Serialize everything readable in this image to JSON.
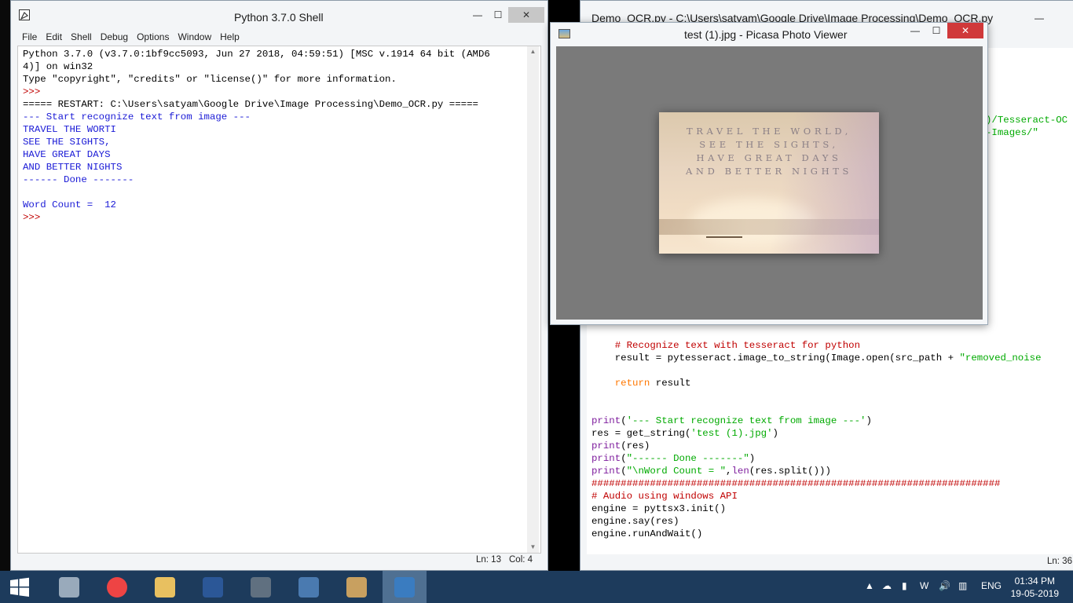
{
  "shell": {
    "title": "Python 3.7.0 Shell",
    "menu": [
      "File",
      "Edit",
      "Shell",
      "Debug",
      "Options",
      "Window",
      "Help"
    ],
    "lines": [
      {
        "text": "Python 3.7.0 (v3.7.0:1bf9cc5093, Jun 27 2018, 04:59:51) [MSC v.1914 64 bit (AMD6",
        "color": "blk"
      },
      {
        "text": "4)] on win32",
        "color": "blk"
      },
      {
        "text": "Type \"copyright\", \"credits\" or \"license()\" for more information.",
        "color": "blk"
      },
      {
        "text": ">>> ",
        "color": "red"
      },
      {
        "text": "===== RESTART: C:\\Users\\satyam\\Google Drive\\Image Processing\\Demo_OCR.py =====",
        "color": "blk"
      },
      {
        "text": "--- Start recognize text from image ---",
        "color": "blu"
      },
      {
        "text": "TRAVEL THE WORTI",
        "color": "blu"
      },
      {
        "text": "SEE THE SIGHTS,",
        "color": "blu"
      },
      {
        "text": "HAVE GREAT DAYS",
        "color": "blu"
      },
      {
        "text": "AND BETTER NIGHTS",
        "color": "blu"
      },
      {
        "text": "------ Done -------",
        "color": "blu"
      },
      {
        "text": "",
        "color": "blu"
      },
      {
        "text": "Word Count =  12",
        "color": "blu"
      },
      {
        "text": ">>> ",
        "color": "red"
      }
    ],
    "status_ln": "Ln: 13",
    "status_col": "Col: 4"
  },
  "editor": {
    "title": "Demo_OCR.py - C:\\Users\\satyam\\Google Drive\\Image Processing\\Demo_OCR.py",
    "visible_top": [
      {
        "text": ")/Tesseract-OC",
        "color": "grn"
      },
      {
        "text": "-Images/\"",
        "color": "grn"
      }
    ],
    "code": [
      [
        {
          "t": "    ",
          "c": "blk"
        },
        {
          "t": "# Recognize text with tesseract for python",
          "c": "red"
        }
      ],
      [
        {
          "t": "    result = pytesseract.image_to_string(Image.open(src_path + ",
          "c": "blk"
        },
        {
          "t": "\"removed_noise",
          "c": "grn"
        }
      ],
      [
        {
          "t": "",
          "c": "blk"
        }
      ],
      [
        {
          "t": "    ",
          "c": "blk"
        },
        {
          "t": "return",
          "c": "org"
        },
        {
          "t": " result",
          "c": "blk"
        }
      ],
      [
        {
          "t": "",
          "c": "blk"
        }
      ],
      [
        {
          "t": "",
          "c": "blk"
        }
      ],
      [
        {
          "t": "print",
          "c": "pur"
        },
        {
          "t": "(",
          "c": "blk"
        },
        {
          "t": "'--- Start recognize text from image ---'",
          "c": "grn"
        },
        {
          "t": ")",
          "c": "blk"
        }
      ],
      [
        {
          "t": "res = get_string(",
          "c": "blk"
        },
        {
          "t": "'test (1).jpg'",
          "c": "grn"
        },
        {
          "t": ")",
          "c": "blk"
        }
      ],
      [
        {
          "t": "print",
          "c": "pur"
        },
        {
          "t": "(res)",
          "c": "blk"
        }
      ],
      [
        {
          "t": "print",
          "c": "pur"
        },
        {
          "t": "(",
          "c": "blk"
        },
        {
          "t": "\"------ Done -------\"",
          "c": "grn"
        },
        {
          "t": ")",
          "c": "blk"
        }
      ],
      [
        {
          "t": "print",
          "c": "pur"
        },
        {
          "t": "(",
          "c": "blk"
        },
        {
          "t": "\"\\nWord Count = \"",
          "c": "grn"
        },
        {
          "t": ",",
          "c": "blk"
        },
        {
          "t": "len",
          "c": "pur"
        },
        {
          "t": "(res.split()))",
          "c": "blk"
        }
      ],
      [
        {
          "t": "######################################################################",
          "c": "red"
        }
      ],
      [
        {
          "t": "# Audio using windows API",
          "c": "red"
        }
      ],
      [
        {
          "t": "engine = pyttsx3.init()",
          "c": "blk"
        }
      ],
      [
        {
          "t": "engine.say(res)",
          "c": "blk"
        }
      ],
      [
        {
          "t": "engine.runAndWait()",
          "c": "blk"
        }
      ]
    ],
    "status_ln": "Ln: 36"
  },
  "picasa": {
    "title": "test (1).jpg - Picasa Photo Viewer",
    "photo_lines": [
      "TRAVEL THE WORLD,",
      "SEE THE SIGHTS,",
      "HAVE GREAT DAYS",
      "AND BETTER NIGHTS"
    ]
  },
  "taskbar": {
    "apps": [
      {
        "name": "resource-monitor",
        "color": "#9ab"
      },
      {
        "name": "chrome",
        "color": "#e44"
      },
      {
        "name": "file-explorer",
        "color": "#e8c060"
      },
      {
        "name": "word",
        "color": "#2b5797"
      },
      {
        "name": "calculator",
        "color": "#607080"
      },
      {
        "name": "python-idle",
        "color": "#4a7ab0"
      },
      {
        "name": "paint",
        "color": "#c8a060"
      },
      {
        "name": "picasa-photo-viewer",
        "color": "#3a7cc0"
      }
    ],
    "lang": "ENG",
    "time": "01:34 PM",
    "date": "19-05-2019"
  }
}
